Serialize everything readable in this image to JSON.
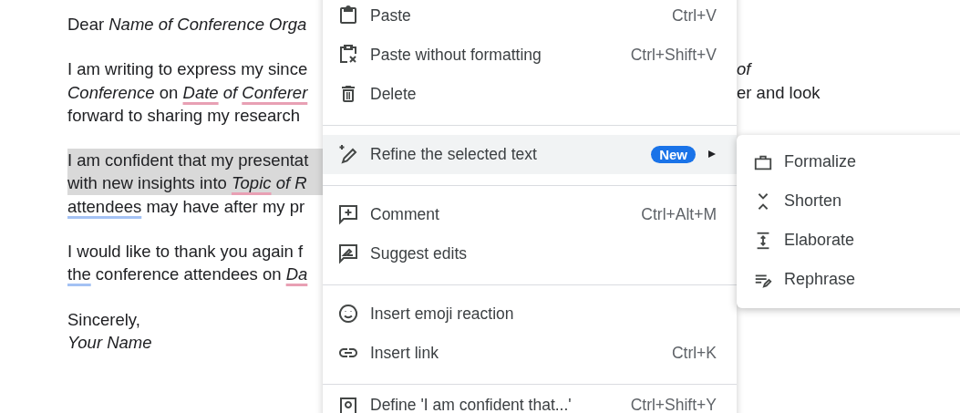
{
  "document": {
    "paragraphs": [
      {
        "lines": [
          {
            "selected": false,
            "left": [
              {
                "text": "Dear ",
                "italic": false,
                "misspelled": false,
                "grammar_issue": false
              },
              {
                "text": "Name of Conference Orga",
                "italic": true,
                "misspelled": false,
                "grammar_issue": false
              }
            ]
          }
        ]
      },
      {
        "lines": [
          {
            "selected": false,
            "left": [
              {
                "text": "I am writing to express my since",
                "italic": false,
                "misspelled": false,
                "grammar_issue": false
              }
            ],
            "right": [
              {
                "text": "of",
                "italic": true,
                "misspelled": false,
                "grammar_issue": false
              }
            ]
          },
          {
            "selected": false,
            "left": [
              {
                "text": "Conference",
                "italic": true,
                "misspelled": false,
                "grammar_issue": false
              },
              {
                "text": " on ",
                "italic": false,
                "misspelled": false,
                "grammar_issue": false
              },
              {
                "text": "Date",
                "italic": true,
                "misspelled": true,
                "grammar_issue": false
              },
              {
                "text": " of ",
                "italic": true,
                "misspelled": false,
                "grammar_issue": false
              },
              {
                "text": "Conferer",
                "italic": true,
                "misspelled": true,
                "grammar_issue": false
              }
            ],
            "right": [
              {
                "text": "er and look",
                "italic": false,
                "misspelled": false,
                "grammar_issue": false
              }
            ]
          },
          {
            "selected": false,
            "left": [
              {
                "text": "forward to sharing my research",
                "italic": false,
                "misspelled": false,
                "grammar_issue": false
              }
            ]
          }
        ]
      },
      {
        "lines": [
          {
            "selected": true,
            "left": [
              {
                "text": "I am confident that my presentat",
                "italic": false,
                "misspelled": false,
                "grammar_issue": false
              }
            ]
          },
          {
            "selected": true,
            "left": [
              {
                "text": "with new insights into ",
                "italic": false,
                "misspelled": false,
                "grammar_issue": false
              },
              {
                "text": "Topic",
                "italic": true,
                "misspelled": true,
                "grammar_issue": false
              },
              {
                "text": " of R",
                "italic": true,
                "misspelled": false,
                "grammar_issue": false
              }
            ]
          },
          {
            "selected": false,
            "left": [
              {
                "text": "attendees",
                "italic": false,
                "misspelled": false,
                "grammar_issue": true
              },
              {
                "text": " may have after my pr",
                "italic": false,
                "misspelled": false,
                "grammar_issue": false
              }
            ]
          }
        ]
      },
      {
        "lines": [
          {
            "selected": false,
            "left": [
              {
                "text": "I would like to thank you again f",
                "italic": false,
                "misspelled": false,
                "grammar_issue": false
              }
            ]
          },
          {
            "selected": false,
            "left": [
              {
                "text": "the",
                "italic": false,
                "misspelled": false,
                "grammar_issue": true
              },
              {
                "text": " conference attendees on ",
                "italic": false,
                "misspelled": false,
                "grammar_issue": false
              },
              {
                "text": "Da",
                "italic": true,
                "misspelled": true,
                "grammar_issue": false
              }
            ]
          }
        ]
      },
      {
        "lines": [
          {
            "selected": false,
            "left": [
              {
                "text": "Sincerely,",
                "italic": false,
                "misspelled": false,
                "grammar_issue": false
              }
            ]
          },
          {
            "selected": false,
            "left": [
              {
                "text": "Your Name",
                "italic": true,
                "misspelled": false,
                "grammar_issue": false
              }
            ]
          }
        ]
      }
    ]
  },
  "context_menu": {
    "sections": [
      [
        {
          "label": "Paste",
          "shortcut": "Ctrl+V",
          "highlighted": false
        },
        {
          "label": "Paste without formatting",
          "shortcut": "Ctrl+Shift+V",
          "highlighted": false
        },
        {
          "label": "Delete",
          "highlighted": false
        }
      ],
      [
        {
          "label": "Refine the selected text",
          "badge": "New",
          "submenu": true,
          "highlighted": true
        }
      ],
      [
        {
          "label": "Comment",
          "shortcut": "Ctrl+Alt+M",
          "highlighted": false
        },
        {
          "label": "Suggest edits",
          "highlighted": false
        }
      ],
      [
        {
          "label": "Insert emoji reaction",
          "highlighted": false
        },
        {
          "label": "Insert link",
          "shortcut": "Ctrl+K",
          "highlighted": false
        }
      ],
      [
        {
          "label": "Define 'I am confident that...'",
          "shortcut": "Ctrl+Shift+Y",
          "highlighted": false
        }
      ]
    ]
  },
  "submenu": {
    "items": [
      {
        "label": "Formalize"
      },
      {
        "label": "Shorten"
      },
      {
        "label": "Elaborate"
      },
      {
        "label": "Rephrase"
      }
    ]
  }
}
